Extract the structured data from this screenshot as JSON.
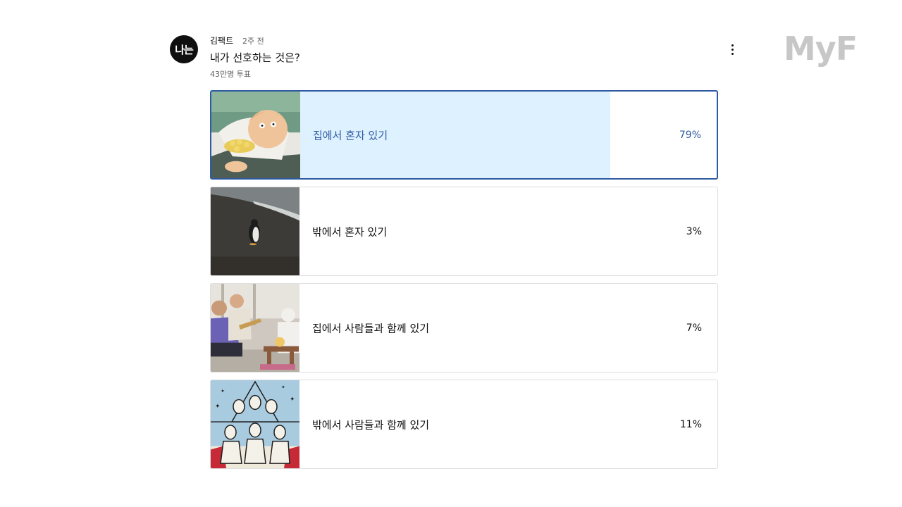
{
  "post": {
    "avatar_text": "나는",
    "channel": "김팩트",
    "time": "2주 전",
    "question": "내가 선호하는 것은?",
    "votes": "43만명 투표"
  },
  "watermark": "MyF",
  "colors": {
    "accent": "#2f5aa3",
    "selected_fill": "#def1ff",
    "bar_fill": "#e6e6e6"
  },
  "options": [
    {
      "label": "집에서 혼자 있기",
      "percent_text": "79%",
      "percent": 79,
      "selected": true,
      "thumb": "cartoon-man-in-bed-image"
    },
    {
      "label": "밖에서 혼자 있기",
      "percent_text": "3%",
      "percent": 3,
      "selected": false,
      "thumb": "penguin-on-beach-image"
    },
    {
      "label": "집에서 사람들과 함께 있기",
      "percent_text": "7%",
      "percent": 7,
      "selected": false,
      "thumb": "people-partying-image"
    },
    {
      "label": "밖에서 사람들과 함께 있기",
      "percent_text": "11%",
      "percent": 11,
      "selected": false,
      "thumb": "cartoon-crowd-image"
    }
  ]
}
